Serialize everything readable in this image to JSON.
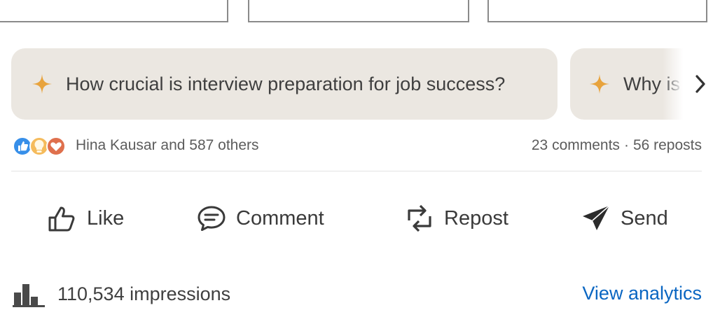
{
  "suggestions": [
    {
      "icon": "sparkle-icon",
      "text": "How crucial is interview preparation for job success?"
    },
    {
      "icon": "sparkle-icon",
      "text": "Why is"
    }
  ],
  "carousel": {
    "next_icon": "chevron-right-icon"
  },
  "social": {
    "reaction_icons": [
      "like-reaction-icon",
      "insightful-reaction-icon",
      "love-reaction-icon"
    ],
    "reactions_text": "Hina Kausar and 587 others",
    "comments": "23 comments",
    "separator": "·",
    "reposts": "56 reposts"
  },
  "actions": [
    {
      "icon": "thumbs-up-icon",
      "label": "Like"
    },
    {
      "icon": "comment-icon",
      "label": "Comment"
    },
    {
      "icon": "repost-icon",
      "label": "Repost"
    },
    {
      "icon": "send-icon",
      "label": "Send"
    }
  ],
  "impressions": {
    "icon": "bar-chart-icon",
    "text": "110,534 impressions"
  },
  "analytics_link": "View analytics",
  "colors": {
    "chip_bg": "#ebe7e1",
    "sparkle": "#e8a33c",
    "link": "#0a66c2",
    "like": "#378fe9",
    "love": "#df704d",
    "insight": "#f5bb5c"
  }
}
